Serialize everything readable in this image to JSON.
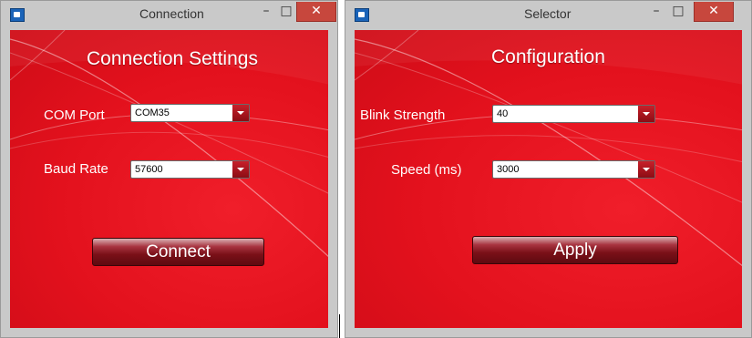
{
  "windows": {
    "connection": {
      "title": "Connection",
      "minimize": "–",
      "maximize": "□",
      "close": "✕",
      "heading": "Connection Settings",
      "com_port": {
        "label": "COM Port",
        "value": "COM35"
      },
      "baud_rate": {
        "label": "Baud Rate",
        "value": "57600"
      },
      "button": "Connect"
    },
    "selector": {
      "title": "Selector",
      "minimize": "–",
      "maximize": "□",
      "close": "✕",
      "heading": "Configuration",
      "blink_strength": {
        "label": "Blink Strength",
        "value": "40"
      },
      "speed": {
        "label": "Speed (ms)",
        "value": "3000"
      },
      "button": "Apply"
    }
  },
  "colors": {
    "client_red": "#e3111d",
    "close_red": "#c7473d",
    "button_dark": "#7a1018"
  }
}
